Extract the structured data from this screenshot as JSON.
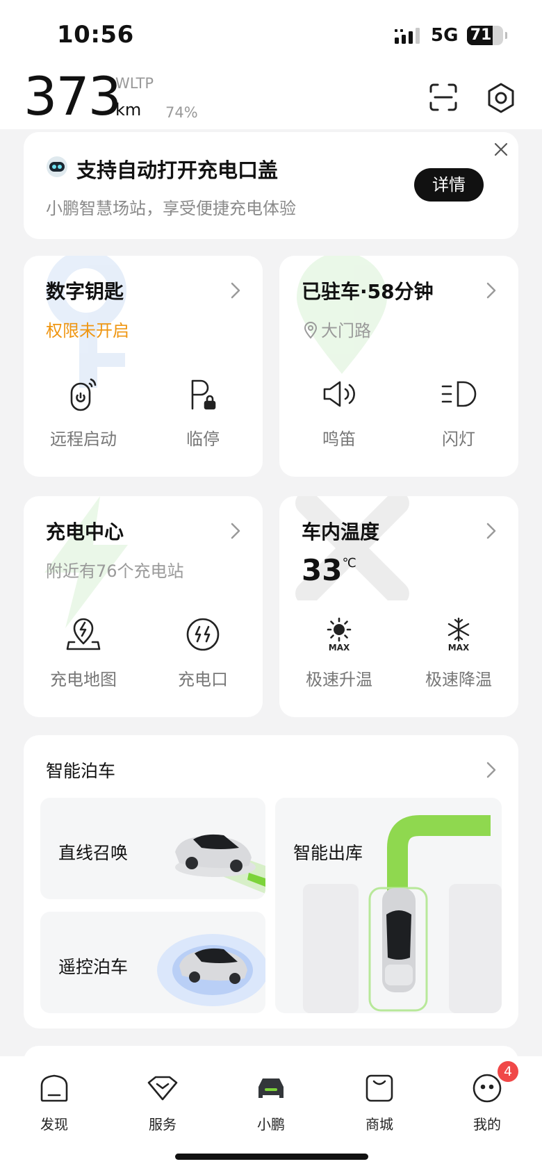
{
  "status_bar": {
    "time": "10:56",
    "network": "5G",
    "battery": "71",
    "battery_level": 0.71
  },
  "header": {
    "range_value": "373",
    "range_standard": "WLTP",
    "range_unit": "km",
    "battery_percent": "74%"
  },
  "notice": {
    "title": "支持自动打开充电口盖",
    "subtitle": "小鹏智慧场站，享受便捷充电体验",
    "detail_button": "详情"
  },
  "digital_key": {
    "title": "数字钥匙",
    "status": "权限未开启",
    "actions": [
      "远程启动",
      "临停"
    ]
  },
  "parked": {
    "title": "已驻车·58分钟",
    "location": "大门路",
    "actions": [
      "鸣笛",
      "闪灯"
    ]
  },
  "charging": {
    "title": "充电中心",
    "subtitle": "附近有76个充电站",
    "actions": [
      "充电地图",
      "充电口"
    ]
  },
  "cabin_temp": {
    "title": "车内温度",
    "value": "33",
    "unit": "℃",
    "actions": [
      "极速升温",
      "极速降温"
    ]
  },
  "smart_parking": {
    "title": "智能泊车",
    "options": [
      "直线召唤",
      "遥控泊车",
      "智能出库"
    ]
  },
  "tabs": [
    {
      "label": "发现",
      "icon": "discover-icon"
    },
    {
      "label": "服务",
      "icon": "service-icon"
    },
    {
      "label": "小鹏",
      "icon": "car-icon"
    },
    {
      "label": "商城",
      "icon": "store-icon"
    },
    {
      "label": "我的",
      "icon": "profile-icon"
    }
  ],
  "profile_badge": "4",
  "colors": {
    "accent_orange": "#ef9612",
    "green": "#7cd33a",
    "badge_red": "#f04848"
  }
}
